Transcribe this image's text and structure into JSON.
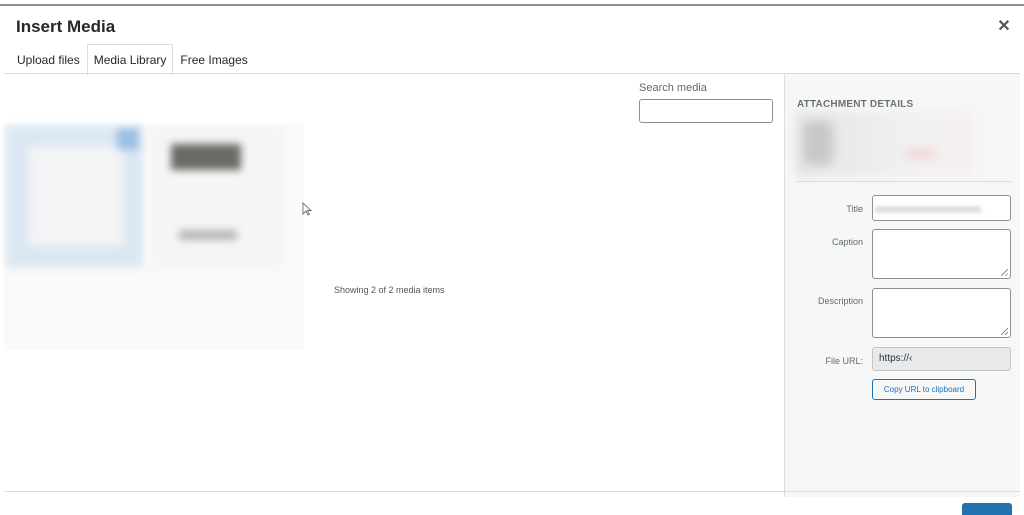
{
  "modal": {
    "title": "Insert Media",
    "close_icon": "close-icon"
  },
  "tabs": [
    {
      "label": "Upload files",
      "active": false
    },
    {
      "label": "Media Library",
      "active": true
    },
    {
      "label": "Free Images",
      "active": false
    }
  ],
  "search": {
    "label": "Search media",
    "value": ""
  },
  "library": {
    "status_text": "Showing 2 of 2 media items",
    "items_count": 2
  },
  "details": {
    "heading": "ATTACHMENT DETAILS",
    "title_label": "Title",
    "caption_label": "Caption",
    "description_label": "Description",
    "file_url_label": "File URL:",
    "file_url_value": "https://‹",
    "copy_button": "Copy URL to clipboard"
  },
  "colors": {
    "accent": "#2271b1",
    "border": "#dcdcde",
    "sidebar_bg": "#f6f7f7"
  }
}
